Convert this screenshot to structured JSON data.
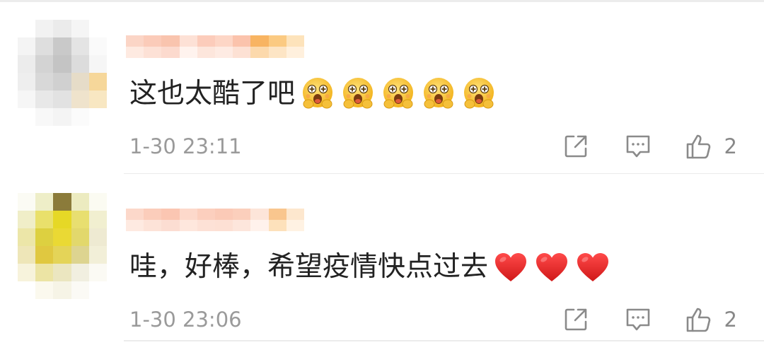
{
  "comments": [
    {
      "text": "这也太酷了吧",
      "emoji_icon": "hugging-face-emoji",
      "emoji_count": 5,
      "time": "1-30 23:11",
      "like_count": "2"
    },
    {
      "text": "哇，好棒，希望疫情快点过去",
      "emoji_icon": "red-heart-emoji",
      "emoji_count": 3,
      "time": "1-30 23:06",
      "like_count": "2"
    }
  ],
  "icons": {
    "share": "share-icon",
    "comment": "comment-icon",
    "like": "thumbs-up-icon"
  },
  "colors": {
    "text": "#222222",
    "meta": "#9a9a9a",
    "icon": "#8a8a8a",
    "heart": "#e32b2b",
    "emoji": "#f6c12d"
  }
}
